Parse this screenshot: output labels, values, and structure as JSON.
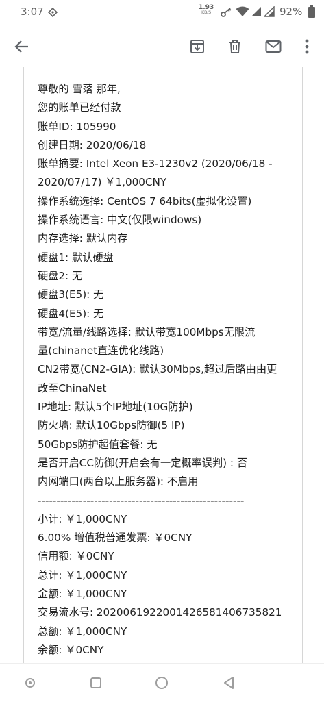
{
  "status_bar": {
    "time": "3:07",
    "net_speed_value": "1.93",
    "net_speed_unit": "KB/S",
    "battery": "92%",
    "icons": [
      "notification-icon",
      "vpn-key-icon",
      "wifi-icon",
      "signal-icon",
      "signal-icon",
      "battery-icon"
    ]
  },
  "toolbar": {
    "icons": [
      "back-arrow-icon",
      "archive-icon",
      "delete-icon",
      "mail-icon",
      "more-vert-icon"
    ]
  },
  "email": {
    "lines": [
      "尊敬的 雪落 那年,",
      "您的账单已经付款",
      "账单ID: 105990",
      "创建日期: 2020/06/18",
      "账单摘要: Intel Xeon E3-1230v2 (2020/06/18 -",
      "2020/07/17) ￥1,000CNY",
      "操作系统选择: CentOS 7 64bits(虚拟化设置)",
      "操作系统语言: 中文(仅限windows)",
      "内存选择: 默认内存",
      "硬盘1: 默认硬盘",
      "硬盘2: 无",
      "硬盘3(E5): 无",
      "硬盘4(E5): 无",
      "带宽/流量/线路选择: 默认带宽100Mbps无限流",
      "量(chinanet直连优化线路)",
      "CN2带宽(CN2-GIA): 默认30Mbps,超过后路由由更",
      "改至ChinaNet",
      "IP地址: 默认5个IP地址(10G防护)",
      "防火墙: 默认10Gbps防御(5 IP)",
      "50Gbps防护超值套餐: 无",
      "是否开启CC防御(开启会有一定概率误判) : 否",
      "内网端口(两台以上服务器): 不启用",
      "-------------------------------------------------------",
      "小计: ￥1,000CNY",
      "6.00% 增值税普通发票: ￥0CNY",
      "信用额: ￥0CNY",
      "总计: ￥1,000CNY",
      "金额: ￥1,000CNY",
      "交易流水号: 2020061922001426581406735821",
      "总额: ￥1,000CNY",
      "余额: ￥0CNY"
    ]
  },
  "nav_bar": {
    "icons": [
      "assistant-icon",
      "recents-icon",
      "home-icon",
      "back-icon"
    ]
  }
}
